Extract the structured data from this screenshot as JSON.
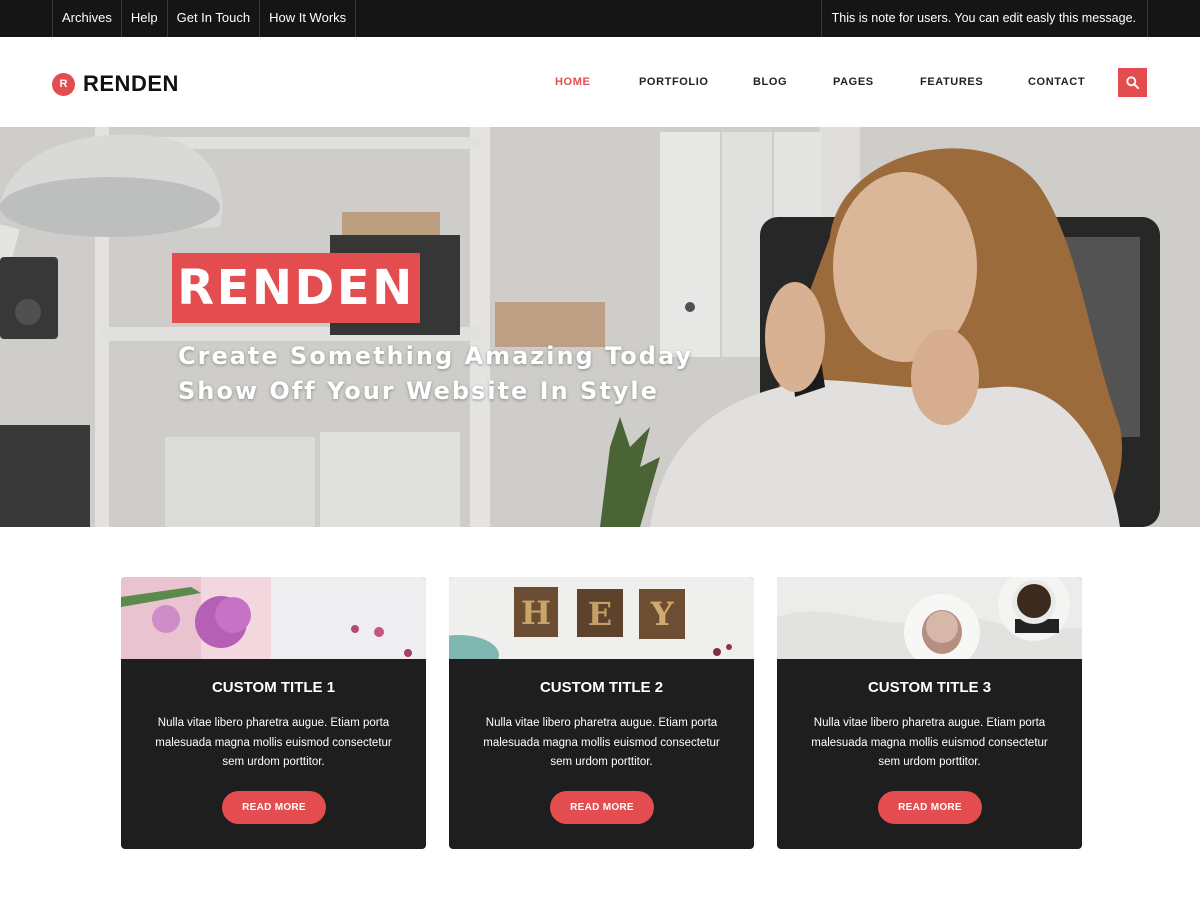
{
  "topbar": {
    "links": [
      "Archives",
      "Help",
      "Get In Touch",
      "How It Works"
    ],
    "note": "This is note for users. You can edit easly this message."
  },
  "header": {
    "logo_badge": "R",
    "logo_text": "RENDEN",
    "nav": [
      "HOME",
      "PORTFOLIO",
      "BLOG",
      "PAGES",
      "FEATURES",
      "CONTACT"
    ],
    "active_nav": "HOME",
    "search_icon": "search-icon"
  },
  "hero": {
    "title": "RENDEN",
    "subtitle_line1": "Create Something Amazing Today",
    "subtitle_line2": "Show Off Your Website In Style"
  },
  "cards": [
    {
      "title": "CUSTOM TITLE 1",
      "desc_line1": "Nulla vitae libero pharetra augue. Etiam porta",
      "desc_line2": "malesuada magna mollis euismod consectetur",
      "desc_line3": "sem urdom porttitor.",
      "button": "READ MORE"
    },
    {
      "title": "CUSTOM TITLE 2",
      "desc_line1": "Nulla vitae libero pharetra augue. Etiam porta",
      "desc_line2": "malesuada magna mollis euismod consectetur",
      "desc_line3": "sem urdom porttitor.",
      "button": "READ MORE",
      "image_letters": [
        "H",
        "E",
        "Y"
      ]
    },
    {
      "title": "CUSTOM TITLE 3",
      "desc_line1": "Nulla vitae libero pharetra augue. Etiam porta",
      "desc_line2": "malesuada magna mollis euismod consectetur",
      "desc_line3": "sem urdom porttitor.",
      "button": "READ MORE"
    }
  ],
  "colors": {
    "accent": "#e34d4f",
    "topbar_bg": "#151515",
    "card_bg": "#1f1e1f"
  }
}
